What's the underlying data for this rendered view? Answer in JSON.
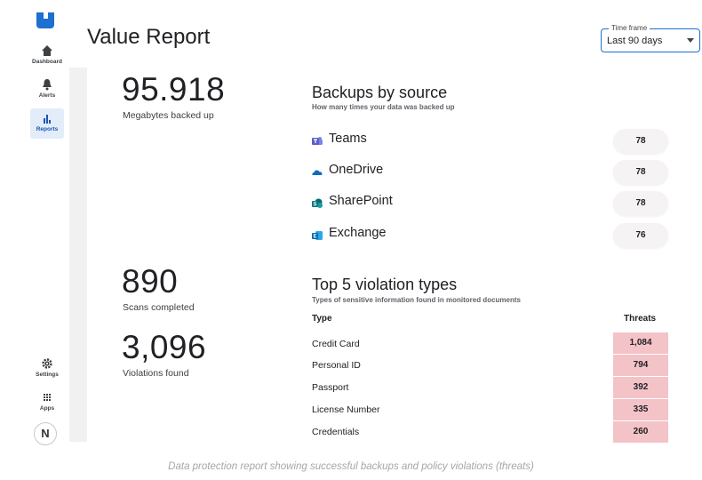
{
  "sidebar": {
    "items": [
      {
        "label": "Dashboard",
        "icon": "home-icon"
      },
      {
        "label": "Alerts",
        "icon": "bell-icon"
      },
      {
        "label": "Reports",
        "icon": "bar-chart-icon"
      },
      {
        "label": "Settings",
        "icon": "gear-icon"
      },
      {
        "label": "Apps",
        "icon": "grid-icon"
      }
    ],
    "avatar_initial": "N",
    "accent_color": "#1d6fd0"
  },
  "header": {
    "title": "Value Report",
    "time_frame": {
      "legend": "Time frame",
      "value": "Last 90 days"
    }
  },
  "stats": {
    "backed_up": {
      "value": "95.918",
      "label": "Megabytes backed up"
    },
    "scans": {
      "value": "890",
      "label": "Scans completed"
    },
    "violations": {
      "value": "3,096",
      "label": "Violations found"
    }
  },
  "backups": {
    "title": "Backups by source",
    "subtitle": "How many times your data was backed up",
    "sources": [
      {
        "name": "Teams",
        "count": "78",
        "icon": "teams-icon",
        "color": "#5b5fc7"
      },
      {
        "name": "OneDrive",
        "count": "78",
        "icon": "onedrive-icon",
        "color": "#0f6cbd"
      },
      {
        "name": "SharePoint",
        "count": "78",
        "icon": "sharepoint-icon",
        "color": "#03787c"
      },
      {
        "name": "Exchange",
        "count": "76",
        "icon": "exchange-icon",
        "color": "#0a64ad"
      }
    ]
  },
  "violations": {
    "title": "Top 5 violation types",
    "subtitle": "Types of sensitive information found in monitored documents",
    "col_type": "Type",
    "col_threats": "Threats",
    "highlight_color": "#f4c3c8",
    "rows": [
      {
        "type": "Credit Card",
        "threats": "1,084"
      },
      {
        "type": "Personal ID",
        "threats": "794"
      },
      {
        "type": "Passport",
        "threats": "392"
      },
      {
        "type": "License Number",
        "threats": "335"
      },
      {
        "type": "Credentials",
        "threats": "260"
      }
    ]
  },
  "caption": "Data protection report showing successful backups and policy violations (threats)"
}
